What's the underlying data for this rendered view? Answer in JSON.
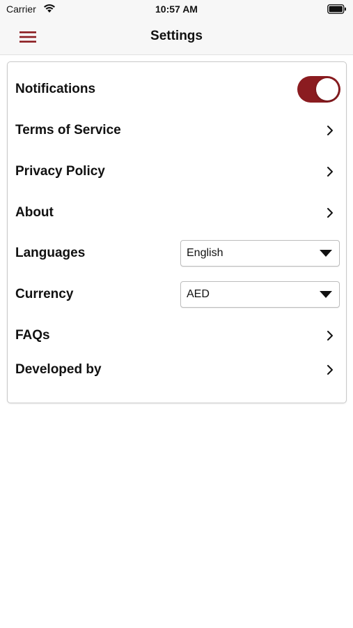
{
  "status_bar": {
    "carrier": "Carrier",
    "time": "10:57 AM"
  },
  "nav": {
    "title": "Settings",
    "menu_icon": "hamburger-menu-icon"
  },
  "colors": {
    "accent": "#8b1c20",
    "card_border": "#c9c9c9"
  },
  "settings": {
    "notifications": {
      "label": "Notifications",
      "enabled": true
    },
    "terms": {
      "label": "Terms of Service"
    },
    "privacy": {
      "label": "Privacy Policy"
    },
    "about": {
      "label": "About"
    },
    "languages": {
      "label": "Languages",
      "selected": "English"
    },
    "currency": {
      "label": "Currency",
      "selected": "AED"
    },
    "faqs": {
      "label": "FAQs"
    },
    "developed_by": {
      "label": "Developed by"
    }
  }
}
